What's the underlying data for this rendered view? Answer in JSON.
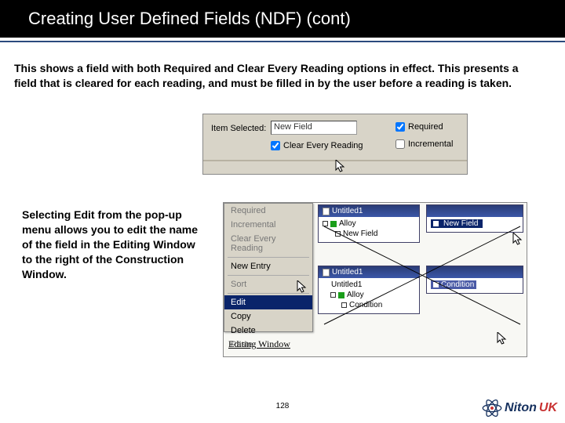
{
  "header": {
    "title": "Creating User Defined Fields (NDF) (cont)"
  },
  "para1": "This shows a field with both Required and Clear Every Reading options in effect. This presents a field that is cleared for each reading, and must be filled in by the user before a reading is taken.",
  "para2": "Selecting Edit from the pop-up menu allows you to edit the name of the field in the Editing Window to the right of the Construction Window.",
  "fig1": {
    "item_selected_label": "Item Selected:",
    "item_selected_value": "New Field",
    "clear_every_reading": "Clear Every Reading",
    "required": "Required",
    "incremental": "Incremental"
  },
  "fig2": {
    "menu": {
      "required": "Required",
      "incremental": "Incremental",
      "clear": "Clear Every Reading",
      "new_entry": "New Entry",
      "sort": "Sort",
      "edit": "Edit",
      "copy": "Copy",
      "delete": "Delete",
      "paste": "Paste"
    },
    "winA": {
      "title": "Untitled1",
      "alloy": "Alloy",
      "newfield": "New Field"
    },
    "winB": {
      "newfield": "New Field"
    },
    "winC": {
      "title": "Untitled1",
      "untitled": "Untitled1",
      "alloy": "Alloy",
      "condition": "Condition"
    },
    "winD": {
      "condition": "Condition"
    },
    "editing_label": "Editing Window"
  },
  "page_number": "128",
  "brand": {
    "name": "Niton",
    "suffix": "UK"
  }
}
